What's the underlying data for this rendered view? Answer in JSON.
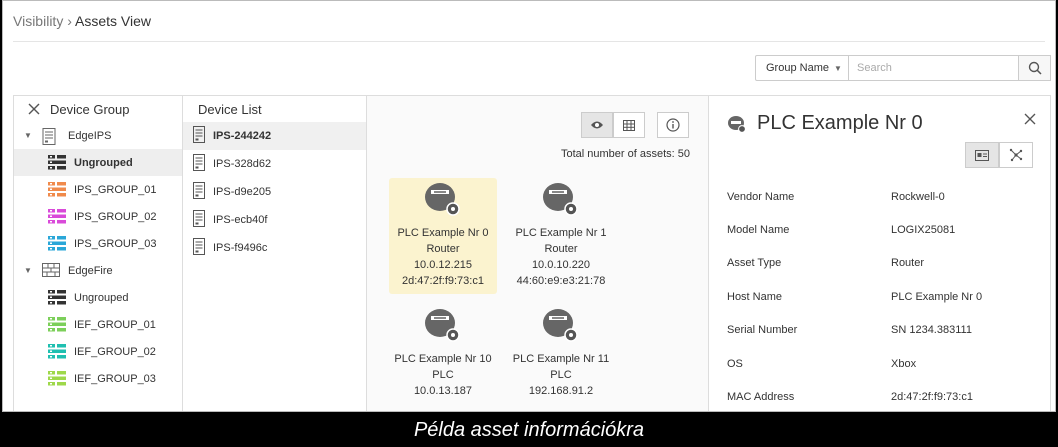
{
  "breadcrumb": {
    "parent": "Visibility",
    "sep": "›",
    "current": "Assets View"
  },
  "search": {
    "group_label": "Group Name",
    "placeholder": "Search"
  },
  "device_group": {
    "title": "Device Group",
    "items": [
      {
        "label": "EdgeIPS",
        "level": 1,
        "caret": "▼",
        "icon": "server-icon",
        "color": "#666666"
      },
      {
        "label": "Ungrouped",
        "level": 2,
        "icon": "group-icon",
        "color": "#333333",
        "selected": true
      },
      {
        "label": "IPS_GROUP_01",
        "level": 2,
        "icon": "group-icon",
        "color": "#f08a4b"
      },
      {
        "label": "IPS_GROUP_02",
        "level": 2,
        "icon": "group-icon",
        "color": "#d94ad9"
      },
      {
        "label": "IPS_GROUP_03",
        "level": 2,
        "icon": "group-icon",
        "color": "#2aa7d8"
      },
      {
        "label": "EdgeFire",
        "level": 1,
        "caret": "▼",
        "icon": "firewall-icon",
        "color": "#666666"
      },
      {
        "label": "Ungrouped",
        "level": 2,
        "icon": "group-icon",
        "color": "#333333"
      },
      {
        "label": "IEF_GROUP_01",
        "level": 2,
        "icon": "group-icon",
        "color": "#7ccf5a"
      },
      {
        "label": "IEF_GROUP_02",
        "level": 2,
        "icon": "group-icon",
        "color": "#1fbfb0"
      },
      {
        "label": "IEF_GROUP_03",
        "level": 2,
        "icon": "group-icon",
        "color": "#9ed84a"
      }
    ]
  },
  "device_list": {
    "title": "Device List",
    "items": [
      {
        "label": "IPS-244242",
        "selected": true
      },
      {
        "label": "IPS-328d62"
      },
      {
        "label": "IPS-d9e205"
      },
      {
        "label": "IPS-ecb40f"
      },
      {
        "label": "IPS-f9496c"
      }
    ]
  },
  "assets": {
    "total_text": "Total number of assets: 50",
    "cards": [
      {
        "name": "PLC Example Nr 0",
        "type": "Router",
        "ip": "10.0.12.215",
        "mac": "2d:47:2f:f9:73:c1",
        "selected": true
      },
      {
        "name": "PLC Example Nr 1",
        "type": "Router",
        "ip": "10.0.10.220",
        "mac": "44:60:e9:e3:21:78"
      },
      {
        "name": "PLC Example Nr 10",
        "type": "PLC",
        "ip": "10.0.13.187",
        "mac": ""
      },
      {
        "name": "PLC Example Nr 11",
        "type": "PLC",
        "ip": "192.168.91.2",
        "mac": ""
      }
    ]
  },
  "detail": {
    "title": "PLC Example Nr 0",
    "props": [
      {
        "key": "Vendor Name",
        "value": "Rockwell-0"
      },
      {
        "key": "Model Name",
        "value": "LOGIX25081"
      },
      {
        "key": "Asset Type",
        "value": "Router"
      },
      {
        "key": "Host Name",
        "value": "PLC Example Nr 0"
      },
      {
        "key": "Serial Number",
        "value": "SN 1234.383111"
      },
      {
        "key": "OS",
        "value": "Xbox"
      },
      {
        "key": "MAC Address",
        "value": "2d:47:2f:f9:73:c1"
      }
    ]
  },
  "caption": "Példa asset információkra"
}
